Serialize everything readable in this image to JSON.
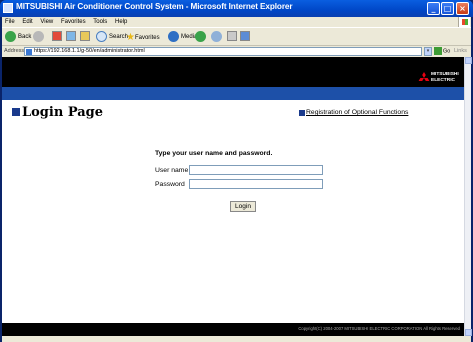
{
  "window": {
    "title": "MITSUBISHI Air Conditioner Control System - Microsoft Internet Explorer"
  },
  "menu": [
    "File",
    "Edit",
    "View",
    "Favorites",
    "Tools",
    "Help"
  ],
  "toolbar": {
    "back_label": "Back",
    "search_label": "Search",
    "favorites_label": "Favorites",
    "media_label": "Media"
  },
  "address": {
    "label": "Address",
    "url": "https://192.168.1.1/g-50/en/administrator.html",
    "go_label": "Go",
    "links_label": "Links"
  },
  "page": {
    "brand_line1": "MITSUBISHI",
    "brand_line2": "ELECTRIC",
    "title": "Login Page",
    "optional_link": "Registration of Optional Functions",
    "instruction": "Type your user name and password.",
    "user_label": "User name",
    "password_label": "Password",
    "user_value": "",
    "password_value": "",
    "login_button": "Login",
    "copyright": "Copyright(C) 2004-2007 MITSUBISHI ELECTRIC CORPORATION All Rights Reserved"
  },
  "colors": {
    "header_black": "#000000",
    "band_blue": "#1d50a8",
    "title_square": "#1a3a8c",
    "brand_red": "#e60012"
  },
  "icons": [
    "back-icon",
    "forward-icon",
    "stop-icon",
    "refresh-icon",
    "home-icon",
    "search-icon",
    "favorites-icon",
    "media-icon",
    "history-icon",
    "mail-icon",
    "print-icon",
    "edit-icon",
    "page-icon",
    "go-icon",
    "mitsubishi-logo-icon"
  ]
}
